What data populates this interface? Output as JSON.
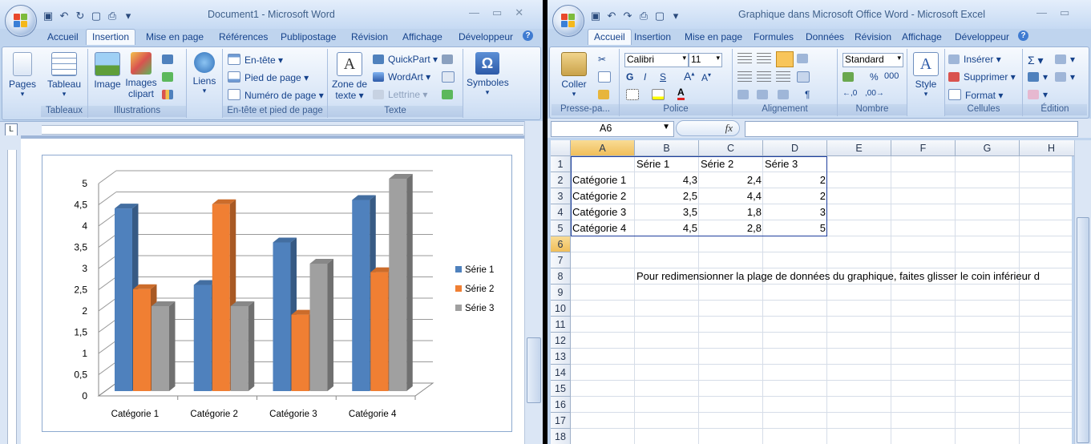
{
  "word": {
    "title": "Document1 - Microsoft Word",
    "tabs": [
      "Accueil",
      "Insertion",
      "Mise en page",
      "Références",
      "Publipostage",
      "Révision",
      "Affichage",
      "Développeur"
    ],
    "active_tab": "Insertion",
    "groups": [
      "Tableaux",
      "Illustrations",
      "En-tête et pied de page",
      "Texte"
    ],
    "buttons": {
      "pages": "Pages",
      "tableau": "Tableau",
      "image": "Image",
      "images_clipart_1": "Images",
      "images_clipart_2": "clipart",
      "liens": "Liens",
      "entete": "En-tête",
      "pied": "Pied de page",
      "numero": "Numéro de page",
      "zone_texte_1": "Zone de",
      "zone_texte_2": "texte",
      "quickpart": "QuickPart",
      "wordart": "WordArt",
      "lettrine": "Lettrine",
      "symboles": "Symboles"
    }
  },
  "excel": {
    "title": "Graphique dans Microsoft Office Word - Microsoft Excel",
    "tabs": [
      "Accueil",
      "Insertion",
      "Mise en page",
      "Formules",
      "Données",
      "Révision",
      "Affichage",
      "Développeur"
    ],
    "active_tab": "Accueil",
    "groups": [
      "Presse-pa...",
      "Police",
      "Alignement",
      "Nombre",
      "Cellules",
      "Édition"
    ],
    "buttons": {
      "coller": "Coller",
      "font": "Calibri",
      "size": "11",
      "bold": "G",
      "italic": "I",
      "underline": "S",
      "number_format": "Standard",
      "percent": "%",
      "thousands": "000",
      "style": "Style",
      "inserer": "Insérer",
      "supprimer": "Supprimer",
      "format": "Format"
    },
    "name_box": "A6",
    "fx": "fx",
    "columns": [
      "A",
      "B",
      "C",
      "D",
      "E",
      "F",
      "G",
      "H"
    ],
    "rows": [
      [
        "",
        "Série 1",
        "Série 2",
        "Série 3"
      ],
      [
        "Catégorie 1",
        "4,3",
        "2,4",
        "2"
      ],
      [
        "Catégorie 2",
        "2,5",
        "4,4",
        "2"
      ],
      [
        "Catégorie 3",
        "3,5",
        "1,8",
        "3"
      ],
      [
        "Catégorie 4",
        "4,5",
        "2,8",
        "5"
      ],
      [
        "",
        "",
        "",
        ""
      ],
      [
        "",
        "",
        "",
        ""
      ],
      [
        "",
        "Pour redimensionner la plage de données du graphique, faites glisser le coin inférieur d",
        "",
        ""
      ]
    ],
    "row_numbers": [
      "1",
      "2",
      "3",
      "4",
      "5",
      "6",
      "7",
      "8",
      "9",
      "10",
      "11",
      "12",
      "13",
      "14",
      "15",
      "16",
      "17",
      "18"
    ]
  },
  "chart_data": {
    "type": "bar",
    "categories": [
      "Catégorie 1",
      "Catégorie 2",
      "Catégorie 3",
      "Catégorie 4"
    ],
    "series": [
      {
        "name": "Série 1",
        "values": [
          4.3,
          2.5,
          3.5,
          4.5
        ],
        "color": "#4f81bd"
      },
      {
        "name": "Série 2",
        "values": [
          2.4,
          4.4,
          1.8,
          2.8
        ],
        "color": "#f07f33"
      },
      {
        "name": "Série 3",
        "values": [
          2,
          2,
          3,
          5
        ],
        "color": "#a0a0a0"
      }
    ],
    "ylim": [
      0,
      5
    ],
    "yticks": [
      "0",
      "0,5",
      "1",
      "1,5",
      "2",
      "2,5",
      "3",
      "3,5",
      "4",
      "4,5",
      "5"
    ],
    "legend": "right",
    "grid": true,
    "style": "3d-clustered-column"
  }
}
